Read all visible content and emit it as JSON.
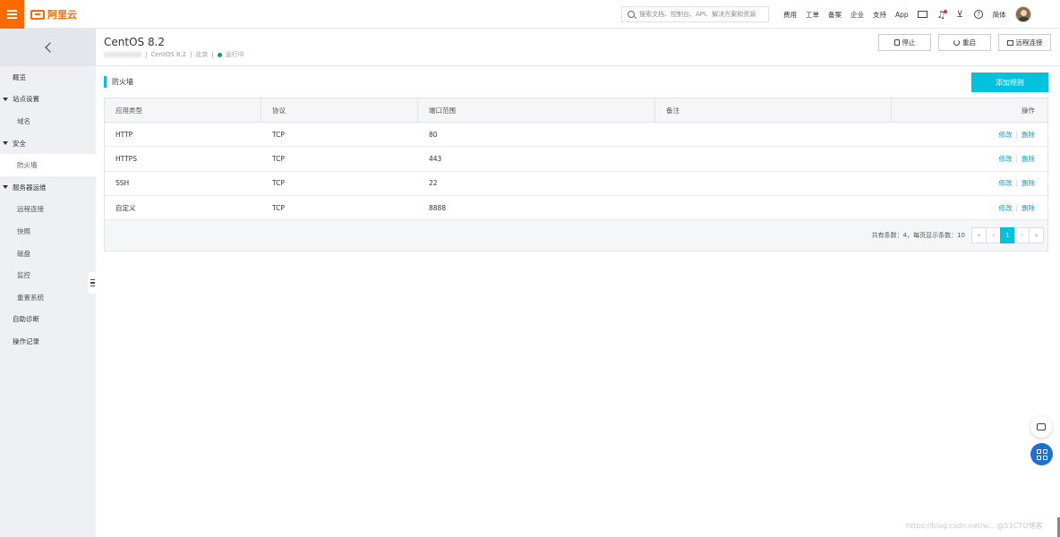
{
  "topbar": {
    "logo_text": "阿里云",
    "search_placeholder": "搜索文档、控制台、API、解决方案和资源",
    "nav": [
      "费用",
      "工单",
      "备案",
      "企业",
      "支持",
      "App"
    ],
    "lang": "简体"
  },
  "sidebar": {
    "items": [
      {
        "label": "概览",
        "type": "top"
      },
      {
        "label": "站点设置",
        "type": "group"
      },
      {
        "label": "域名",
        "type": "sub"
      },
      {
        "label": "安全",
        "type": "group"
      },
      {
        "label": "防火墙",
        "type": "sub",
        "active": true
      },
      {
        "label": "服务器运维",
        "type": "group"
      },
      {
        "label": "远程连接",
        "type": "sub"
      },
      {
        "label": "快照",
        "type": "sub"
      },
      {
        "label": "磁盘",
        "type": "sub"
      },
      {
        "label": "监控",
        "type": "sub"
      },
      {
        "label": "重置系统",
        "type": "sub"
      },
      {
        "label": "自助诊断",
        "type": "top"
      },
      {
        "label": "操作记录",
        "type": "top"
      }
    ]
  },
  "header": {
    "title": "CentOS 8.2",
    "os": "CentOS 8.2",
    "region": "北京",
    "status": "运行中",
    "buttons": {
      "stop": "停止",
      "restart": "重启",
      "remote": "远程连接"
    }
  },
  "firewall": {
    "section_title": "防火墙",
    "add_button": "添加规则",
    "columns": [
      "应用类型",
      "协议",
      "端口范围",
      "备注",
      "操作"
    ],
    "rows": [
      {
        "app": "HTTP",
        "protocol": "TCP",
        "port": "80",
        "note": ""
      },
      {
        "app": "HTTPS",
        "protocol": "TCP",
        "port": "443",
        "note": ""
      },
      {
        "app": "SSH",
        "protocol": "TCP",
        "port": "22",
        "note": ""
      },
      {
        "app": "自定义",
        "protocol": "TCP",
        "port": "8888",
        "note": ""
      }
    ],
    "ops": {
      "edit": "修改",
      "delete": "删除"
    },
    "pagination": {
      "info": "共有条数：4，每页显示条数：10",
      "current": "1"
    }
  },
  "watermark": "https://blog.csdn.net/w... @51CTO博客"
}
